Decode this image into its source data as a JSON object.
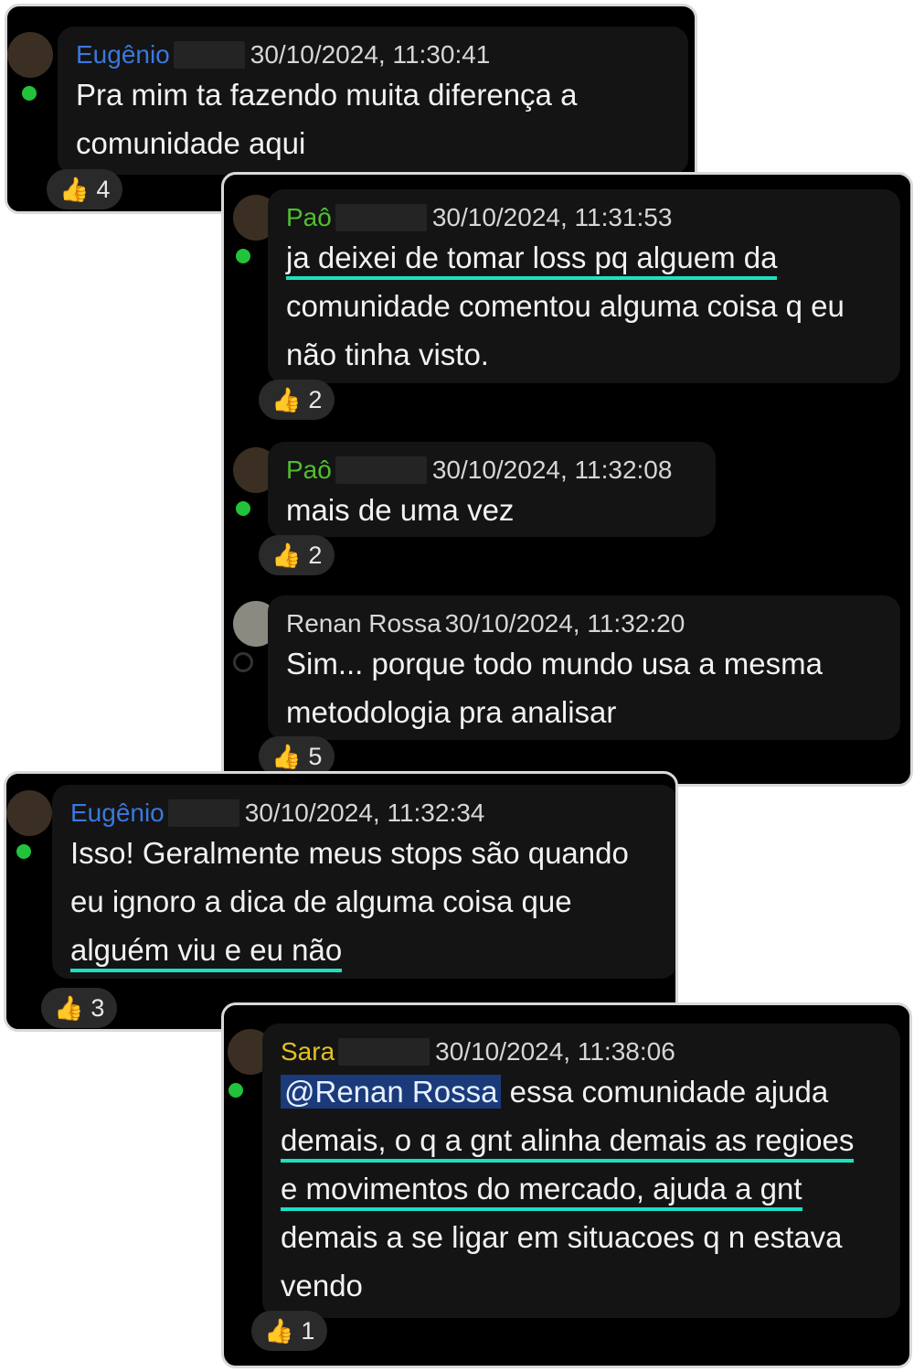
{
  "messages": [
    {
      "author": "Eugênio",
      "author_color": "#3a78e0",
      "timestamp": "30/10/2024, 11:30:41",
      "lines": [
        "Pra mim ta fazendo muita diferença a",
        "comunidade aqui"
      ],
      "reaction_icon": "thumbs-up-icon",
      "reaction_count": "4"
    },
    {
      "author": "Paô",
      "author_color": "#4fbf2f",
      "timestamp": "30/10/2024, 11:31:53",
      "lines": [
        "ja deixei de tomar loss pq alguem da",
        "comunidade comentou alguma coisa q eu",
        "não tinha visto."
      ],
      "reaction_icon": "thumbs-up-icon",
      "reaction_count": "2"
    },
    {
      "author": "Paô",
      "author_color": "#4fbf2f",
      "timestamp": "30/10/2024, 11:32:08",
      "lines": [
        "mais de uma vez"
      ],
      "reaction_icon": "thumbs-up-icon",
      "reaction_count": "2"
    },
    {
      "author": "Renan Rossa",
      "author_color": "#d8d8d8",
      "timestamp": "30/10/2024, 11:32:20",
      "lines": [
        "Sim... porque todo mundo usa a mesma",
        "metodologia pra analisar"
      ],
      "reaction_icon": "thumbs-up-icon",
      "reaction_count": "5"
    },
    {
      "author": "Eugênio",
      "author_color": "#3a78e0",
      "timestamp": "30/10/2024, 11:32:34",
      "lines": [
        "Isso! Geralmente meus stops são quando",
        "eu ignoro a dica de alguma coisa que",
        "alguém viu e eu não"
      ],
      "reaction_icon": "thumbs-up-icon",
      "reaction_count": "3"
    },
    {
      "author": "Sara",
      "author_color": "#e2c022",
      "timestamp": "30/10/2024, 11:38:06",
      "mention": "@Renan Rossa",
      "lines": [
        " essa comunidade ajuda",
        "demais, o q a gnt alinha demais as regioes",
        "e movimentos do mercado, ajuda a gnt",
        "demais a se ligar em situacoes q n estava",
        "vendo"
      ],
      "reaction_icon": "thumbs-up-icon",
      "reaction_count": "1"
    }
  ],
  "colors": {
    "online": "#22c33a",
    "highlight": "#1de0c2",
    "mention_bg": "#1a3a7a"
  }
}
